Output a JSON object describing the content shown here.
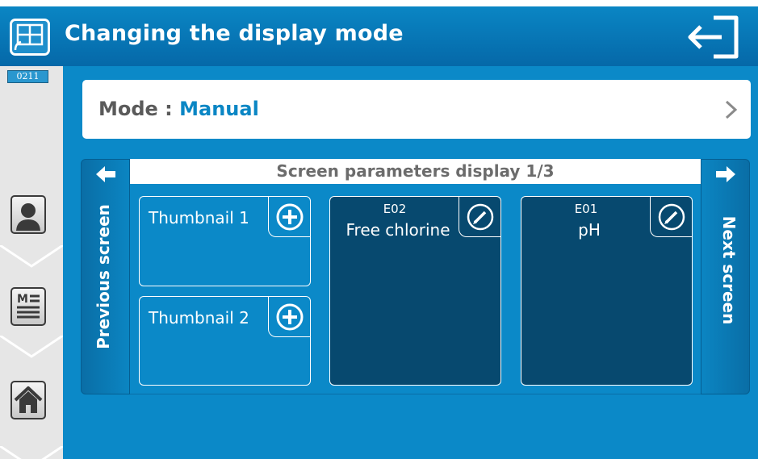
{
  "header": {
    "title": "Changing the display mode",
    "app_icon": "remote-display-icon",
    "exit_icon": "exit-arrow-icon"
  },
  "sidebar": {
    "device_code": "0211",
    "items": [
      {
        "icon": "user-icon"
      },
      {
        "icon": "menu-list-icon"
      },
      {
        "icon": "home-icon"
      }
    ]
  },
  "mode": {
    "label": "Mode : ",
    "value": "Manual"
  },
  "screen": {
    "title": "Screen parameters display 1/3",
    "previous_label": "Previous screen",
    "next_label": "Next screen"
  },
  "thumbnails": [
    {
      "label": "Thumbnail 1",
      "action_icon": "plus-circle-icon"
    },
    {
      "label": "Thumbnail 2",
      "action_icon": "plus-circle-icon"
    }
  ],
  "measures": [
    {
      "code": "E02",
      "name": "Free chlorine",
      "action_icon": "edit-pencil-icon"
    },
    {
      "code": "E01",
      "name": "pH",
      "action_icon": "edit-pencil-icon"
    }
  ],
  "colors": {
    "primary_blue": "#0b89c8",
    "header_blue": "#0568a8",
    "tile_dark": "#07496f",
    "mode_value": "#0a86c4",
    "sidebar_grey": "#e6e6e6"
  }
}
